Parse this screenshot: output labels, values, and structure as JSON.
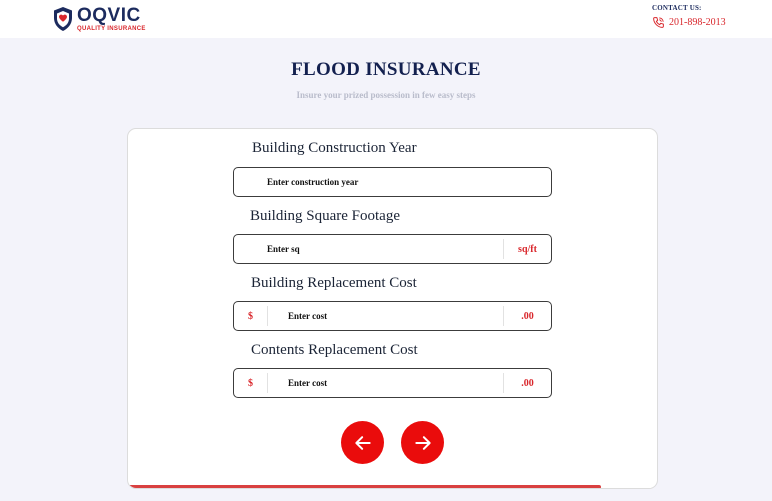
{
  "header": {
    "logo_name": "OQVIC",
    "logo_tagline": "QUALITY INSURANCE",
    "contact_label": "CONTACT US:",
    "contact_phone": "201-898-2013"
  },
  "page": {
    "title": "FLOOD INSURANCE",
    "subtitle": "Insure your prized possession in few easy steps"
  },
  "form": {
    "construction_year": {
      "label": "Building Construction Year",
      "placeholder": "Enter construction year",
      "value": ""
    },
    "square_footage": {
      "label": "Building Square Footage",
      "placeholder": "Enter sq",
      "value": "",
      "suffix": "sq/ft"
    },
    "replacement_cost": {
      "label": "Building Replacement Cost",
      "placeholder": "Enter cost",
      "value": "",
      "prefix": "$",
      "suffix": ".00"
    },
    "contents_cost": {
      "label": "Contents Replacement Cost",
      "placeholder": "Enter cost",
      "value": "",
      "prefix": "$",
      "suffix": ".00"
    }
  },
  "navigation": {
    "back_icon": "arrow-left-icon",
    "next_icon": "arrow-right-icon"
  },
  "progress": {
    "fraction": 0.89
  },
  "colors": {
    "brand_navy": "#1c2b5e",
    "brand_red": "#d9262b",
    "button_red": "#ea0c0c",
    "page_bg": "#f3f3fa"
  }
}
